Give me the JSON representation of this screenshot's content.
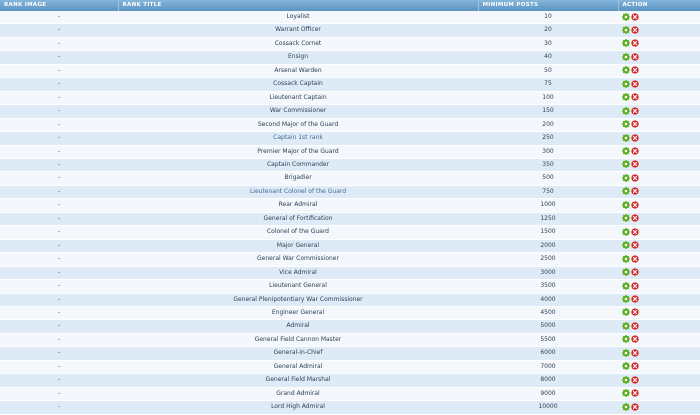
{
  "headers": {
    "rank_image": "RANK IMAGE",
    "rank_title": "RANK TITLE",
    "minimum_posts": "MINIMUM POSTS",
    "action": "ACTION"
  },
  "icons": {
    "edit": "gear-icon",
    "delete": "delete-icon"
  },
  "colors": {
    "header": "#6a9fc8",
    "row_light": "#f4f7fb",
    "row_dark": "#dfeaf7",
    "edit_green": "#5cae1e",
    "delete_red": "#d62a2a"
  },
  "rows": [
    {
      "image": "-",
      "title": "Loyalist",
      "posts": "10"
    },
    {
      "image": "-",
      "title": "Warrant Officer",
      "posts": "20"
    },
    {
      "image": "-",
      "title": "Cossack Cornet",
      "posts": "30"
    },
    {
      "image": "-",
      "title": "Ensign",
      "posts": "40"
    },
    {
      "image": "-",
      "title": "Arsenal Warden",
      "posts": "50"
    },
    {
      "image": "-",
      "title": "Cossack Captain",
      "posts": "75"
    },
    {
      "image": "-",
      "title": "Lieutenant Captain",
      "posts": "100"
    },
    {
      "image": "-",
      "title": "War Commissioner",
      "posts": "150"
    },
    {
      "image": "-",
      "title": "Second Major of the Guard",
      "posts": "200"
    },
    {
      "image": "-",
      "title": "Captain 1st rank",
      "posts": "250"
    },
    {
      "image": "-",
      "title": "Premier Major of the Guard",
      "posts": "300"
    },
    {
      "image": "-",
      "title": "Captain Commander",
      "posts": "350"
    },
    {
      "image": "-",
      "title": "Brigadier",
      "posts": "500"
    },
    {
      "image": "-",
      "title": "Lieutenant Colonel of the Guard",
      "posts": "750"
    },
    {
      "image": "-",
      "title": "Rear Admiral",
      "posts": "1000"
    },
    {
      "image": "-",
      "title": "General of Fortification",
      "posts": "1250"
    },
    {
      "image": "-",
      "title": "Colonel of the Guard",
      "posts": "1500"
    },
    {
      "image": "-",
      "title": "Major General",
      "posts": "2000"
    },
    {
      "image": "-",
      "title": "General War Commissioner",
      "posts": "2500"
    },
    {
      "image": "-",
      "title": "Vice Admiral",
      "posts": "3000"
    },
    {
      "image": "-",
      "title": "Lieutenant General",
      "posts": "3500"
    },
    {
      "image": "-",
      "title": "General Plenipotentiary War Commissioner",
      "posts": "4000"
    },
    {
      "image": "-",
      "title": "Engineer General",
      "posts": "4500"
    },
    {
      "image": "-",
      "title": "Admiral",
      "posts": "5000"
    },
    {
      "image": "-",
      "title": "General Field Cannon Master",
      "posts": "5500"
    },
    {
      "image": "-",
      "title": "General-in-Chief",
      "posts": "6000"
    },
    {
      "image": "-",
      "title": "General Admiral",
      "posts": "7000"
    },
    {
      "image": "-",
      "title": "General Field Marshal",
      "posts": "8000"
    },
    {
      "image": "-",
      "title": "Grand Admiral",
      "posts": "9000"
    },
    {
      "image": "-",
      "title": "Lord High Admiral",
      "posts": "10000"
    }
  ]
}
